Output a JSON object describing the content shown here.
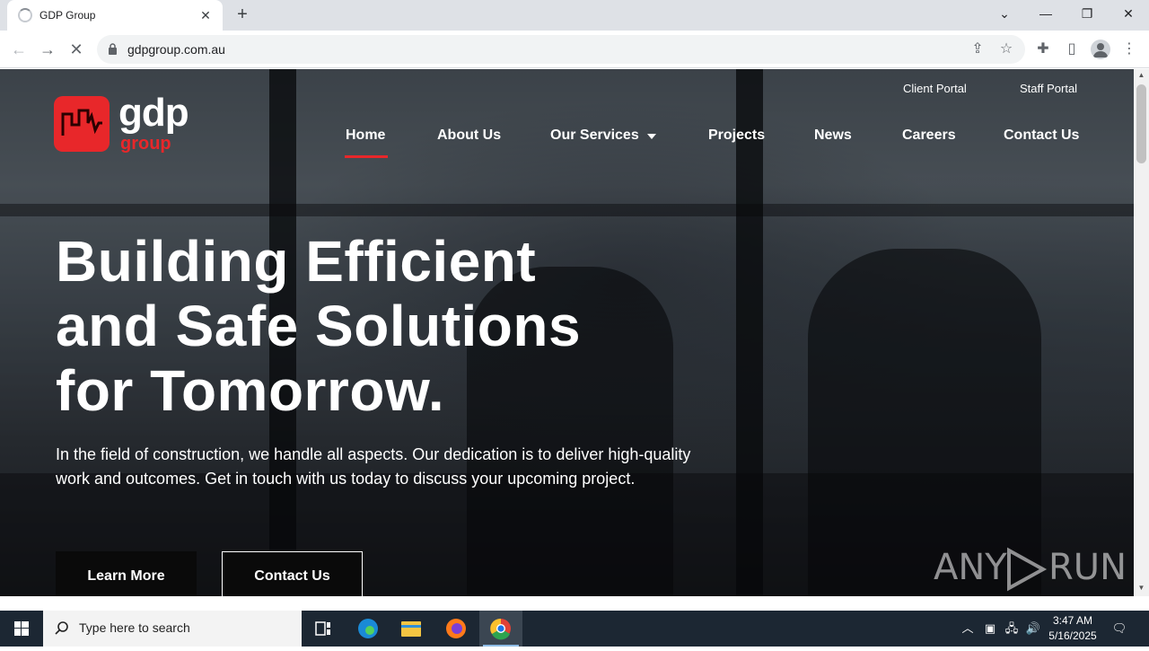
{
  "browser": {
    "tab_title": "GDP Group",
    "tab_close": "✕",
    "new_tab": "+",
    "url": "gdpgroup.com.au",
    "window": {
      "minimize": "—",
      "restore": "❐",
      "close": "✕",
      "tablist": "⌄"
    },
    "nav": {
      "back": "←",
      "forward": "→",
      "stop": "✕"
    },
    "icons": [
      "share-icon",
      "star-icon",
      "extensions-icon",
      "side-panel-icon",
      "profile-icon",
      "menu-icon"
    ]
  },
  "site": {
    "logo": {
      "text": "gdp",
      "sub": "group",
      "brand_color": "#e8272a"
    },
    "top_links": [
      "Client Portal",
      "Staff Portal"
    ],
    "nav": [
      "Home",
      "About Us",
      "Our Services",
      "Projects",
      "News",
      "Careers",
      "Contact Us"
    ],
    "active_nav": "Home",
    "hero": {
      "title_line1": "Building Efficient",
      "title_line2": "and Safe Solutions",
      "title_line3": "for Tomorrow.",
      "text": "In the field of construction, we handle all aspects. Our dedication is to deliver high-quality work and outcomes. Get in touch with us today to discuss your upcoming project.",
      "btn_primary": "Learn More",
      "btn_secondary": "Contact Us"
    }
  },
  "watermark": {
    "left": "ANY",
    "right": "RUN"
  },
  "taskbar": {
    "search_placeholder": "Type here to search",
    "apps": [
      "task-view-icon",
      "edge-icon",
      "file-explorer-icon",
      "firefox-icon",
      "chrome-icon"
    ],
    "active_app": "chrome-icon",
    "time": "3:47 AM",
    "date": "5/16/2025"
  }
}
